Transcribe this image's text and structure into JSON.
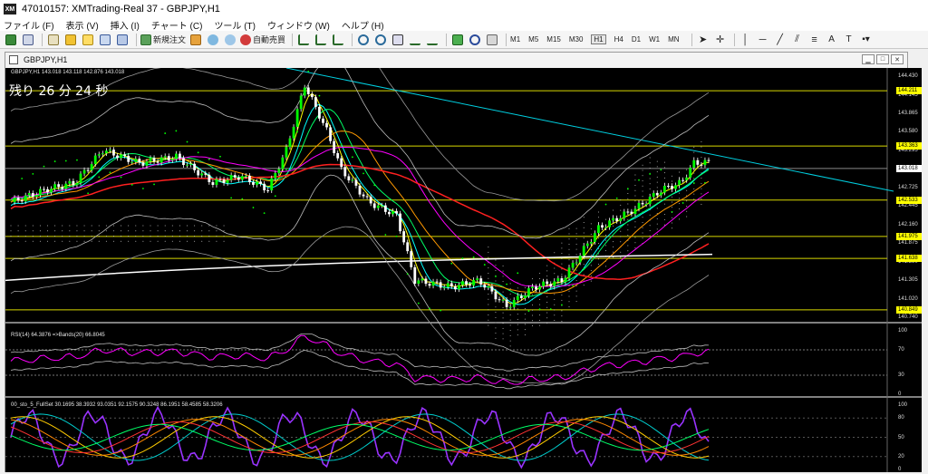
{
  "window": {
    "title": "47010157: XMTrading-Real 37 - GBPJPY,H1",
    "icon_text": "XM"
  },
  "menu": [
    "ファイル (F)",
    "表示 (V)",
    "挿入 (I)",
    "チャート (C)",
    "ツール (T)",
    "ウィンドウ (W)",
    "ヘルプ (H)"
  ],
  "toolbar": {
    "new_order_label": "新規注文",
    "auto_trade_label": "自動売買",
    "timeframes": [
      "M1",
      "M5",
      "M15",
      "M30",
      "H1",
      "H4",
      "D1",
      "W1",
      "MN"
    ],
    "active_timeframe": "H1"
  },
  "chart_window": {
    "title": "GBPJPY,H1"
  },
  "chart": {
    "symbol_info": "GBPJPY,H1  143.018 143.118 142.876 143.018",
    "countdown": "残り 26 分 24 秒",
    "rsi_info": "RSI(14) 64.3876  =>Bands(20) 66.8045",
    "stoch_info": "00_sto_5_FullSet 30.1695 38.3932 93.0351 92.1575 90.3248 86.1951 58.4585 58.3206",
    "price_axis": [
      "144.430",
      "144.145",
      "143.865",
      "143.580",
      "143.295",
      "143.018",
      "142.725",
      "142.445",
      "142.160",
      "141.875",
      "141.590",
      "141.305",
      "141.020",
      "140.740"
    ],
    "highlight_levels": [
      {
        "label": "144.211",
        "value": 144.211,
        "style": "yellow"
      },
      {
        "label": "143.363",
        "value": 143.363,
        "style": "yellow"
      },
      {
        "label": "143.018",
        "value": 143.018,
        "style": "white"
      },
      {
        "label": "142.533",
        "value": 142.533,
        "style": "yellow"
      },
      {
        "label": "141.975",
        "value": 141.975,
        "style": "yellow"
      },
      {
        "label": "141.638",
        "value": 141.638,
        "style": "yellow"
      },
      {
        "label": "140.849",
        "value": 140.849,
        "style": "yellow"
      }
    ],
    "rsi_axis": [
      "100",
      "70",
      "30",
      "0"
    ],
    "stoch_axis": [
      "100",
      "80",
      "50",
      "20",
      "0"
    ],
    "colors": {
      "background": "#000000",
      "candle_up": "#ffffff",
      "candle_bull_fill": "#00ff00",
      "highlight": "#ffff00"
    }
  }
}
